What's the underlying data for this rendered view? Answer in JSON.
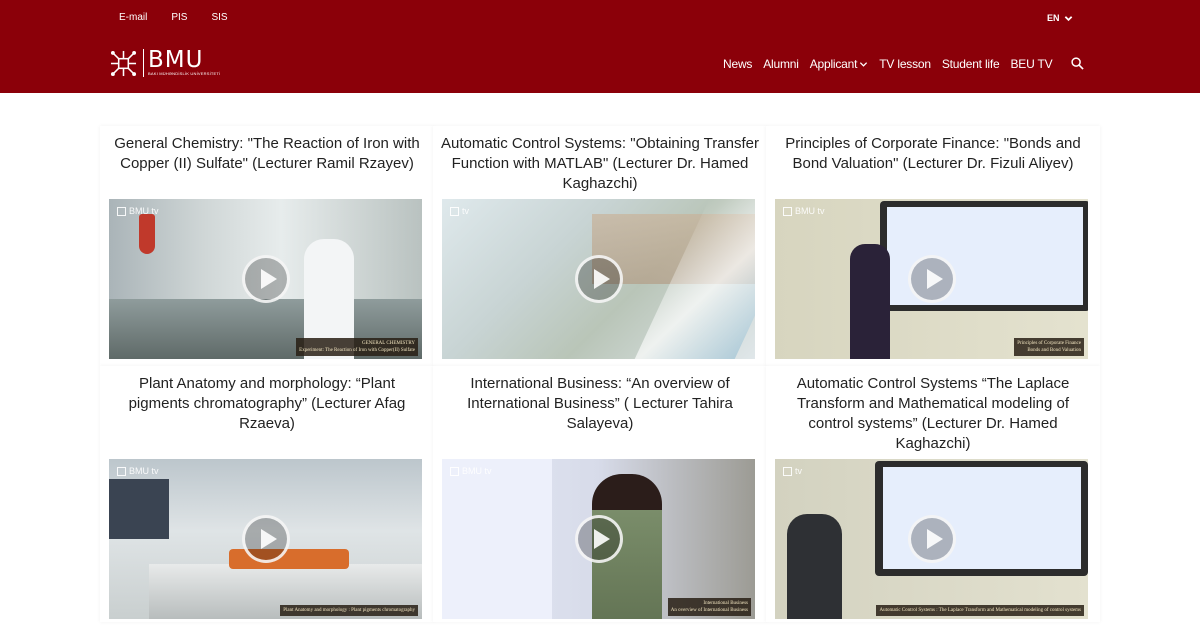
{
  "topbar": {
    "links": [
      "E-mail",
      "PIS",
      "SIS"
    ],
    "language": "EN"
  },
  "logo": {
    "word": "BMU",
    "subtitle": "BAKI MÜHƏNDİSLİK UNİVERSİTETİ"
  },
  "nav": {
    "items": [
      "News",
      "Alumni",
      "Applicant",
      "TV lesson",
      "Student life",
      "BEU TV"
    ]
  },
  "colors": {
    "brand": "#8b0009"
  },
  "videos": [
    {
      "title": "General Chemistry: \"The Reaction of Iron with Copper (II) Sulfate\" (Lecturer Ramil Rzayev)",
      "watermark": "BMU tv",
      "caption_line1": "GENERAL CHEMISTRY",
      "caption_line2": "Experiment: The Reaction of Iron with Copper(II) Sulfate"
    },
    {
      "title": "Automatic Control Systems: \"Obtaining Transfer Function with MATLAB\" (Lecturer Dr. Hamed Kaghazchi)",
      "watermark": "tv",
      "caption_line1": "",
      "caption_line2": ""
    },
    {
      "title": "Principles of Corporate Finance: \"Bonds and Bond Valuation\" (Lecturer Dr. Fizuli Aliyev)",
      "watermark": "BMU tv",
      "caption_line1": "Principles of Corporate Finance",
      "caption_line2": "Bonds and Bond Valuation"
    },
    {
      "title": "Plant Anatomy and morphology: “Plant pigments chromatography” (Lecturer Afag Rzaeva)",
      "watermark": "BMU tv",
      "caption_line1": "",
      "caption_line2": "Plant Anatomy and morphology : Plant pigments chromatography"
    },
    {
      "title": "International Business: “An overview of International Business” ( Lecturer Tahira Salayeva)",
      "watermark": "BMU tv",
      "caption_line1": "International Business",
      "caption_line2": "An overview of International Business"
    },
    {
      "title": "Automatic Control Systems “The Laplace Transform and Mathematical modeling of control systems” (Lecturer Dr. Hamed Kaghazchi)",
      "watermark": "tv",
      "caption_line1": "",
      "caption_line2": "Automatic Control Systems : The Laplace Transform and Mathematical modeling of control systems"
    }
  ]
}
